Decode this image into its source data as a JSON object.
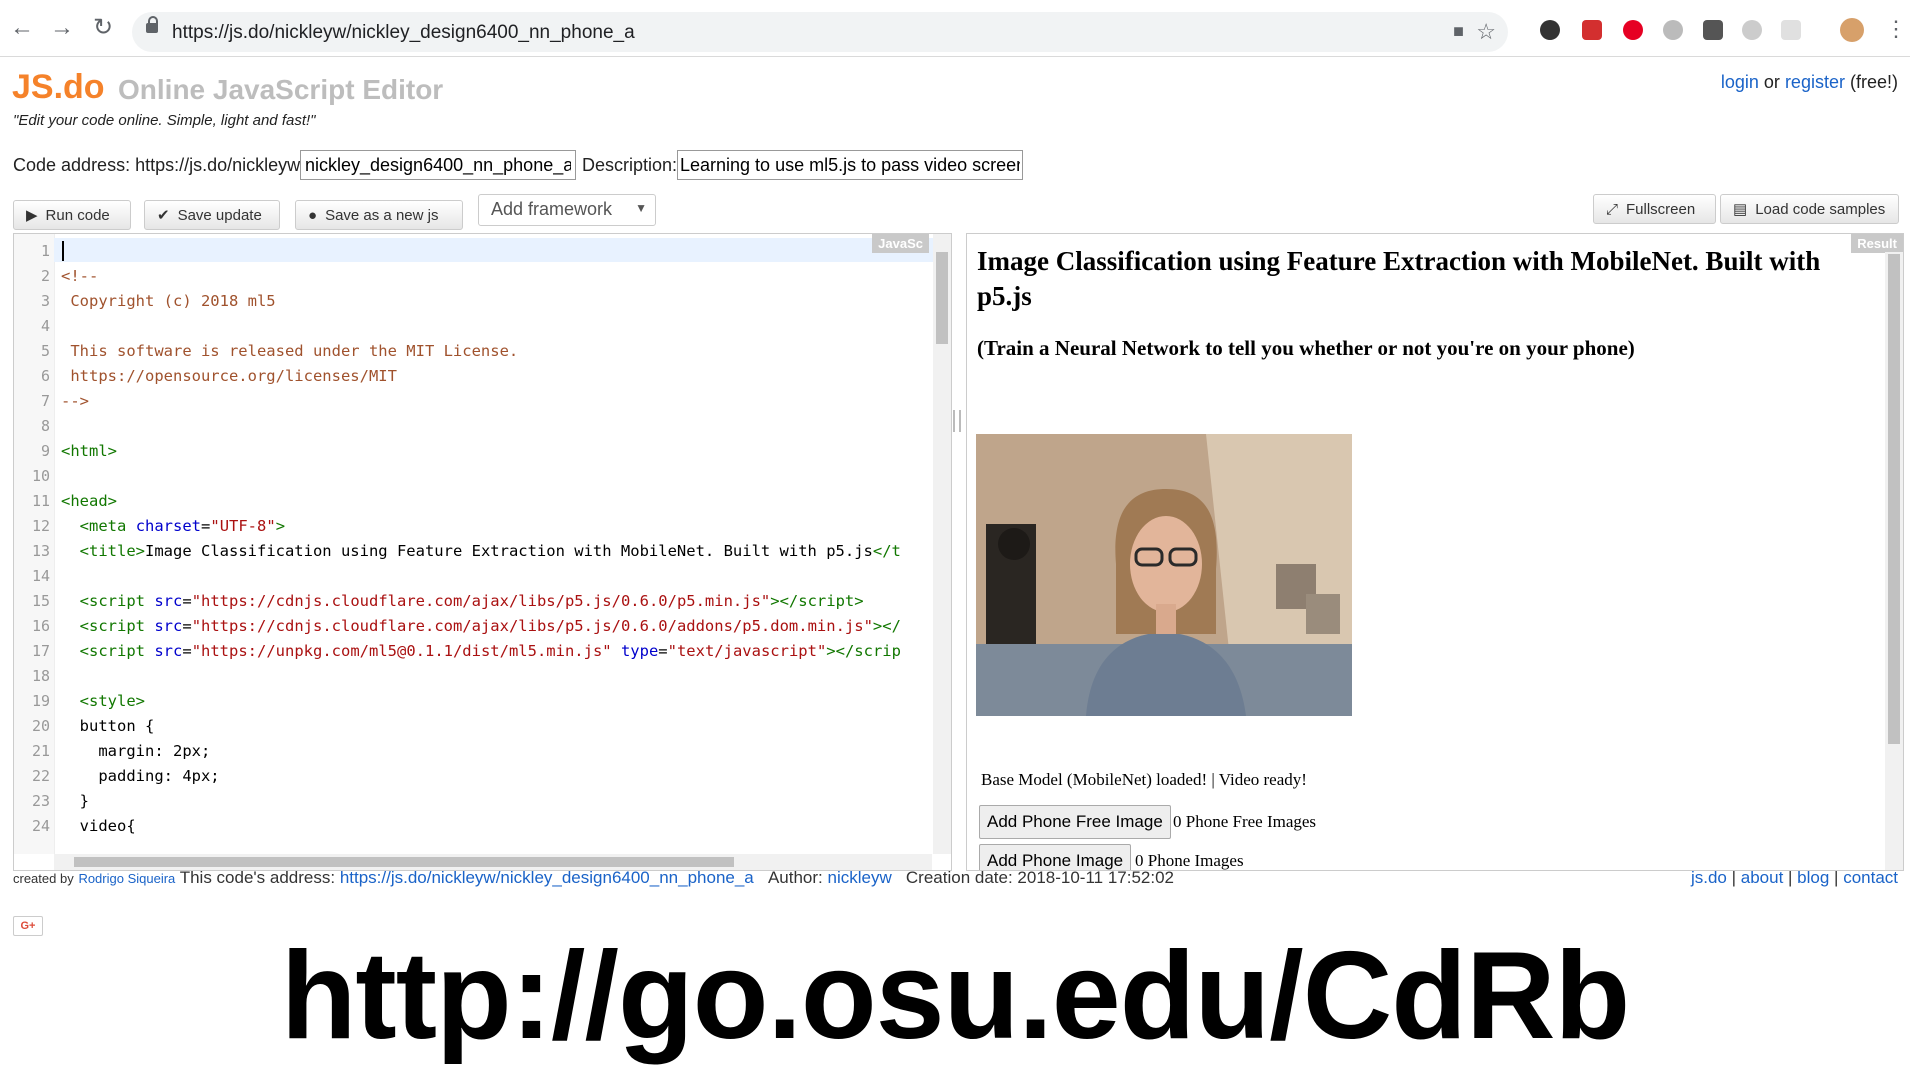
{
  "browser": {
    "url": "https://js.do/nickleyw/nickley_design6400_nn_phone_a"
  },
  "site": {
    "logo": "JS.do",
    "logo_subtitle": "Online JavaScript Editor",
    "tagline": "\"Edit your code online. Simple, light and fast!\"",
    "auth": {
      "login": "login",
      "or": "or",
      "register": "register",
      "free": "(free!)"
    }
  },
  "form": {
    "code_address_label": "Code address: https://js.do/nickleyw/",
    "slug_value": "nickley_design6400_nn_phone_a",
    "description_label": "Description:",
    "description_value": "Learning to use ml5.js to pass video screen"
  },
  "toolbar": {
    "run": "Run code",
    "save_update": "Save update",
    "save_new": "Save as a new js",
    "add_framework": "Add framework",
    "fullscreen": "Fullscreen",
    "load_samples": "Load code samples"
  },
  "editor": {
    "tag": "JavaSc",
    "lines": [
      {
        "n": "1",
        "html": ""
      },
      {
        "n": "2",
        "html": "<span style=\"color:#a0522d\">&lt;!--</span>"
      },
      {
        "n": "3",
        "html": "<span style=\"color:#a0522d\"> Copyright (c) 2018 ml5</span>"
      },
      {
        "n": "4",
        "html": ""
      },
      {
        "n": "5",
        "html": "<span style=\"color:#a0522d\"> This software is released under the MIT License.</span>"
      },
      {
        "n": "6",
        "html": "<span style=\"color:#a0522d\"> https://opensource.org/licenses/MIT</span>"
      },
      {
        "n": "7",
        "html": "<span style=\"color:#a0522d\">--&gt;</span>"
      },
      {
        "n": "8",
        "html": ""
      },
      {
        "n": "9",
        "html": "<span style=\"color:#117700\">&lt;html&gt;</span>"
      },
      {
        "n": "10",
        "html": ""
      },
      {
        "n": "11",
        "html": "<span style=\"color:#117700\">&lt;head&gt;</span>"
      },
      {
        "n": "12",
        "html": "  <span style=\"color:#117700\">&lt;meta</span> <span style=\"color:#0000cc\">charset</span>=<span style=\"color:#aa1111\">\"UTF-8\"</span><span style=\"color:#117700\">&gt;</span>"
      },
      {
        "n": "13",
        "html": "  <span style=\"color:#117700\">&lt;title&gt;</span>Image Classification using Feature Extraction with MobileNet. Built with p5.js<span style=\"color:#117700\">&lt;/t</span>"
      },
      {
        "n": "14",
        "html": ""
      },
      {
        "n": "15",
        "html": "  <span style=\"color:#117700\">&lt;script</span> <span style=\"color:#0000cc\">src</span>=<span style=\"color:#aa1111\">\"https://cdnjs.cloudflare.com/ajax/libs/p5.js/0.6.0/p5.min.js\"</span><span style=\"color:#117700\">&gt;&lt;/script&gt;</span>"
      },
      {
        "n": "16",
        "html": "  <span style=\"color:#117700\">&lt;script</span> <span style=\"color:#0000cc\">src</span>=<span style=\"color:#aa1111\">\"https://cdnjs.cloudflare.com/ajax/libs/p5.js/0.6.0/addons/p5.dom.min.js\"</span><span style=\"color:#117700\">&gt;&lt;/</span>"
      },
      {
        "n": "17",
        "html": "  <span style=\"color:#117700\">&lt;script</span> <span style=\"color:#0000cc\">src</span>=<span style=\"color:#aa1111\">\"https://unpkg.com/ml5@0.1.1/dist/ml5.min.js\"</span> <span style=\"color:#0000cc\">type</span>=<span style=\"color:#aa1111\">\"text/javascript\"</span><span style=\"color:#117700\">&gt;&lt;/scrip</span>"
      },
      {
        "n": "18",
        "html": ""
      },
      {
        "n": "19",
        "html": "  <span style=\"color:#117700\">&lt;style&gt;</span>"
      },
      {
        "n": "20",
        "html": "  button {"
      },
      {
        "n": "21",
        "html": "    margin: 2px;"
      },
      {
        "n": "22",
        "html": "    padding: 4px;"
      },
      {
        "n": "23",
        "html": "  }"
      },
      {
        "n": "24",
        "html": "  video{"
      }
    ]
  },
  "result": {
    "tag": "Result",
    "title": "Image Classification using Feature Extraction with MobileNet. Built with p5.js",
    "subtitle": "(Train a Neural Network to tell you whether or not you're on your phone)",
    "status": "Base Model (MobileNet) loaded! | Video ready!",
    "btn_phone_free": "Add Phone Free Image",
    "count_phone_free": "0 Phone Free Images",
    "btn_phone": "Add Phone Image",
    "count_phone": "0 Phone Images"
  },
  "footer": {
    "created_by": "created by",
    "author_name": "Rodrigo Siqueira",
    "address_label": "This code's address:",
    "address_url": "https://js.do/nickleyw/nickley_design6400_nn_phone_a",
    "author_label": "Author:",
    "author": "nickleyw",
    "creation": "Creation date: 2018-10-11 17:52:02",
    "links": [
      "js.do",
      "about",
      "blog",
      "contact"
    ],
    "gplus": "G+"
  },
  "overlay": {
    "big_url": "http://go.osu.edu/CdRb"
  }
}
